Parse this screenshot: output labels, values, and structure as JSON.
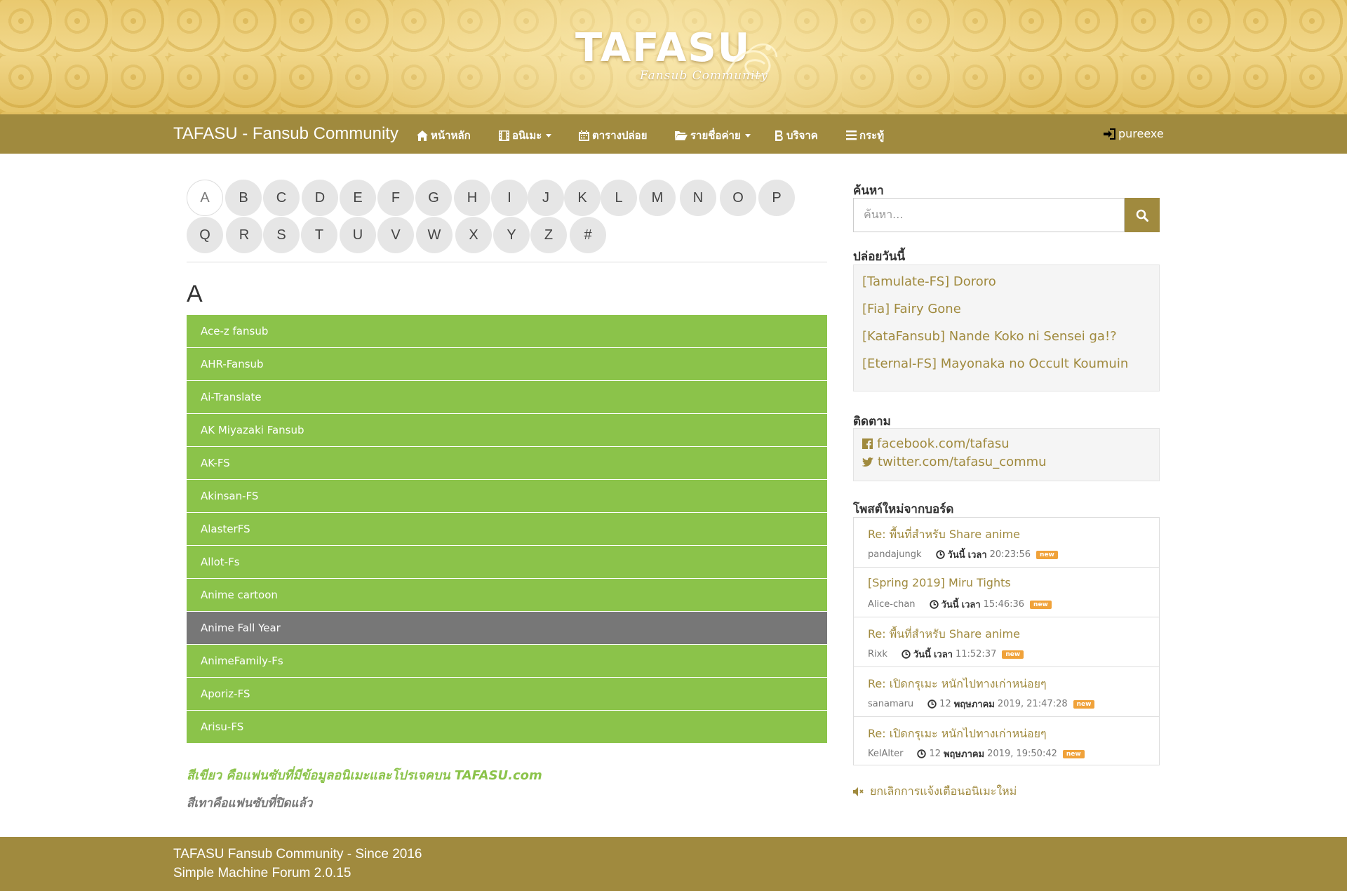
{
  "header": {
    "logo_title": "TAFASU",
    "logo_subtitle": "Fansub Community"
  },
  "navbar": {
    "brand": "TAFASU - Fansub Community",
    "items": [
      {
        "label": "หน้าหลัก",
        "icon": "home-icon"
      },
      {
        "label": "อนิเมะ",
        "icon": "film-icon",
        "dropdown": true
      },
      {
        "label": "ตารางปล่อย",
        "icon": "calendar-icon"
      },
      {
        "label": "รายชื่อค่าย",
        "icon": "folder-open-icon",
        "dropdown": true
      },
      {
        "label": "บริจาค",
        "icon": "bitcoin-icon"
      },
      {
        "label": "กระทู้",
        "icon": "list-icon"
      }
    ],
    "user": {
      "label": "pureexe",
      "icon": "sign-in-icon"
    }
  },
  "alphabet": {
    "row1": [
      "A",
      "B",
      "C",
      "D",
      "E",
      "F",
      "G",
      "H",
      "I",
      "J",
      "K",
      "L",
      "M",
      "N",
      "O",
      "P"
    ],
    "row2": [
      "Q",
      "R",
      "S",
      "T",
      "U",
      "V",
      "W",
      "X",
      "Y",
      "Z",
      "#"
    ],
    "active": "A"
  },
  "section": {
    "letter": "A"
  },
  "fansubs": [
    {
      "name": "Ace-z fansub",
      "status": "green"
    },
    {
      "name": "AHR-Fansub",
      "status": "green"
    },
    {
      "name": "Ai-Translate",
      "status": "green"
    },
    {
      "name": "AK Miyazaki Fansub",
      "status": "green"
    },
    {
      "name": "AK-FS",
      "status": "green"
    },
    {
      "name": "Akinsan-FS",
      "status": "green"
    },
    {
      "name": "AlasterFS",
      "status": "green"
    },
    {
      "name": "Allot-Fs",
      "status": "green"
    },
    {
      "name": "Anime cartoon",
      "status": "green"
    },
    {
      "name": "Anime Fall Year",
      "status": "gray"
    },
    {
      "name": "AnimeFamily-Fs",
      "status": "green"
    },
    {
      "name": "Aporiz-FS",
      "status": "green"
    },
    {
      "name": "Arisu-FS",
      "status": "green"
    }
  ],
  "legend": {
    "green": "สีเขียว คือแฟนซับที่มีข้อมูลอนิเมะและโปรเจคบน TAFASU.com",
    "gray": "สีเทาคือแฟนซับที่ปิดแล้ว"
  },
  "sidebar": {
    "search": {
      "heading": "ค้นหา",
      "placeholder": "ค้นหา...",
      "icon": "search-icon"
    },
    "today": {
      "heading": "ปล่อยวันนี้",
      "items": [
        "[Tamulate-FS] Dororo",
        "[Fia] Fairy Gone",
        "[KataFansub] Nande Koko ni Sensei ga!?",
        "[Eternal-FS] Mayonaka no Occult Koumuin"
      ]
    },
    "follow": {
      "heading": "ติดตาม",
      "facebook": "facebook.com/tafasu",
      "twitter": "twitter.com/tafasu_commu"
    },
    "posts": {
      "heading": "โพสต์ใหม่จากบอร์ด",
      "items": [
        {
          "title": "Re: พื้นที่สำหรับ Share anime",
          "author": "pandajungk",
          "date_prefix": "วันนี้",
          "date_word": "เวลา",
          "time": "20:23:56",
          "badge": "new"
        },
        {
          "title": "[Spring 2019] Miru Tights",
          "author": "Alice-chan",
          "date_prefix": "วันนี้",
          "date_word": "เวลา",
          "time": "15:46:36",
          "badge": "new"
        },
        {
          "title": "Re: พื้นที่สำหรับ Share anime",
          "author": "Rixk",
          "date_prefix": "วันนี้",
          "date_word": "เวลา",
          "time": "11:52:37",
          "badge": "new"
        },
        {
          "title": "Re: เปิดกรุเมะ หนักไปทางเก่าหน่อยๆ",
          "author": "sanamaru",
          "date_prefix": "12",
          "date_word": "พฤษภาคม",
          "time": "2019, 21:47:28",
          "badge": "new"
        },
        {
          "title": "Re: เปิดกรุเมะ หนักไปทางเก่าหน่อยๆ",
          "author": "KelAlter",
          "date_prefix": "12",
          "date_word": "พฤษภาคม",
          "time": "2019, 19:50:42",
          "badge": "new"
        }
      ]
    },
    "mute": {
      "label": "ยกเลิกการแจ้งเตือนอนิเมะใหม่",
      "icon": "volume-off-icon"
    }
  },
  "footer": {
    "line1": "TAFASU Fansub Community - Since 2016",
    "line2": "Simple Machine Forum 2.0.15"
  },
  "colors": {
    "accent": "#a08a3e",
    "green_row": "#8bc34a",
    "gray_row": "#777777",
    "badge": "#f0a23a"
  }
}
